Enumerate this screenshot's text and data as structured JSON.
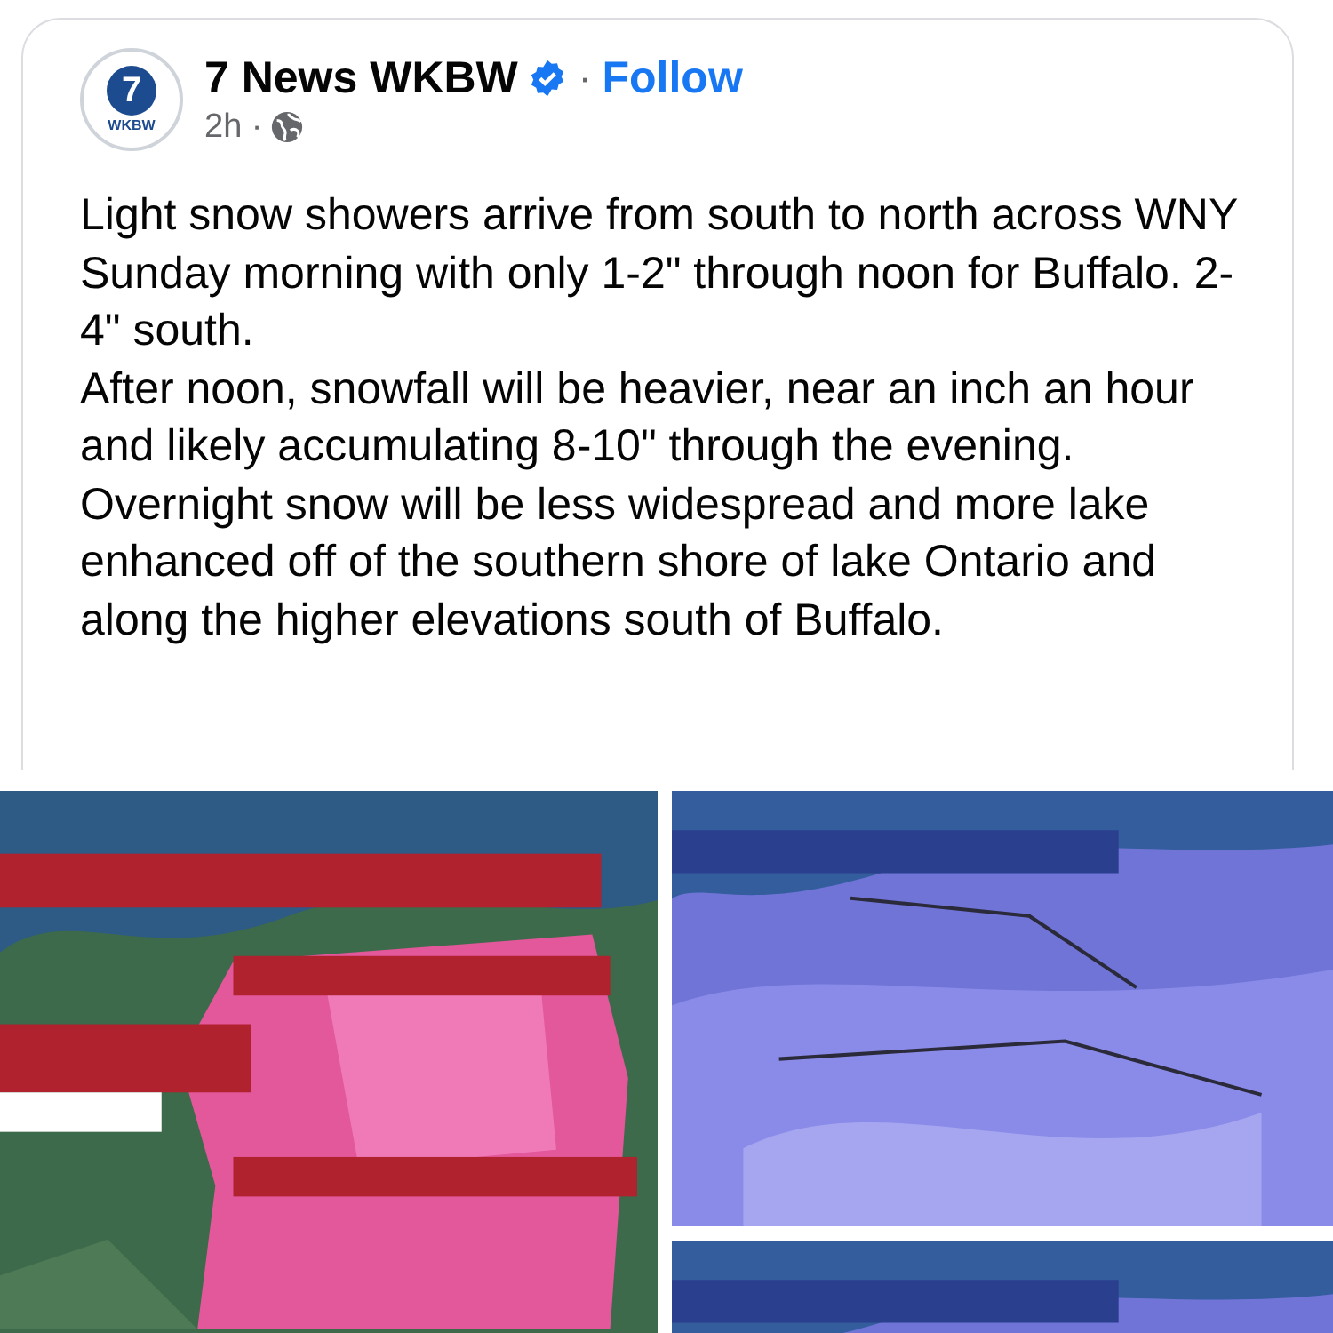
{
  "post": {
    "author": {
      "name": "7 News WKBW",
      "verified": true,
      "logo": {
        "numeral": "7",
        "label": "WKBW"
      }
    },
    "follow": "Follow",
    "separator": "·",
    "time": "2h ·",
    "paragraphs": [
      "Light snow showers arrive from south to north across WNY Sunday morning with only 1-2\" through noon for Buffalo. 2-4\" south.",
      "After noon, snowfall will be heavier, near an inch an hour and likely accumulating 8-10\" through the evening.",
      "Overnight snow will be less widespread and more lake enhanced off of the southern shore of lake Ontario and along the higher elevations south of Buffalo."
    ]
  }
}
